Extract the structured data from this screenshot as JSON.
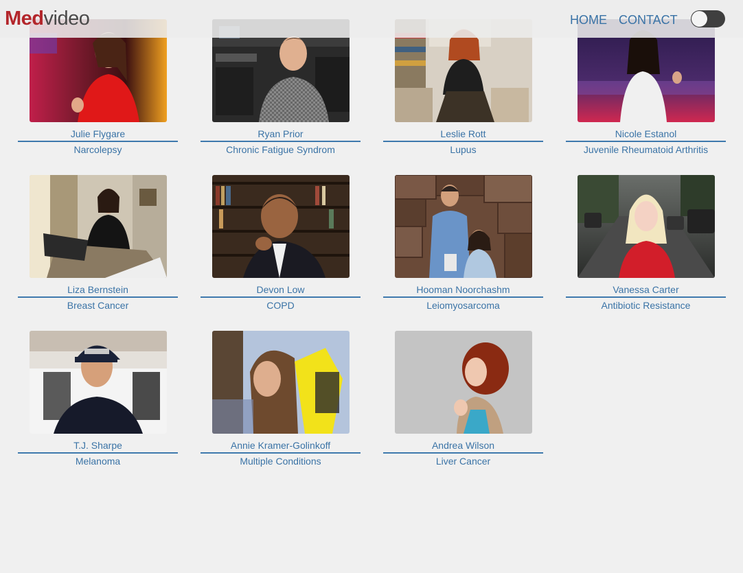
{
  "header": {
    "logo_bold": "Med",
    "logo_light": "video",
    "nav": {
      "home": "HOME",
      "contact": "CONTACT"
    },
    "theme_toggle_on": false
  },
  "colors": {
    "accent": "#3a73a6",
    "brand_red": "#b3262b",
    "background": "#f0f0f0"
  },
  "people": [
    {
      "name": "Julie Flygare",
      "condition": "Narcolepsy"
    },
    {
      "name": "Ryan Prior",
      "condition": "Chronic Fatigue Syndrom"
    },
    {
      "name": "Leslie Rott",
      "condition": "Lupus"
    },
    {
      "name": "Nicole Estanol",
      "condition": "Juvenile Rheumatoid Arthritis"
    },
    {
      "name": "Liza Bernstein",
      "condition": "Breast Cancer"
    },
    {
      "name": "Devon Low",
      "condition": "COPD"
    },
    {
      "name": "Hooman Noorchashm",
      "condition": "Leiomyosarcoma"
    },
    {
      "name": "Vanessa Carter",
      "condition": "Antibiotic Resistance"
    },
    {
      "name": "T.J. Sharpe",
      "condition": "Melanoma"
    },
    {
      "name": "Annie Kramer-Golinkoff",
      "condition": "Multiple Conditions"
    },
    {
      "name": "Andrea Wilson",
      "condition": "Liver Cancer"
    }
  ]
}
